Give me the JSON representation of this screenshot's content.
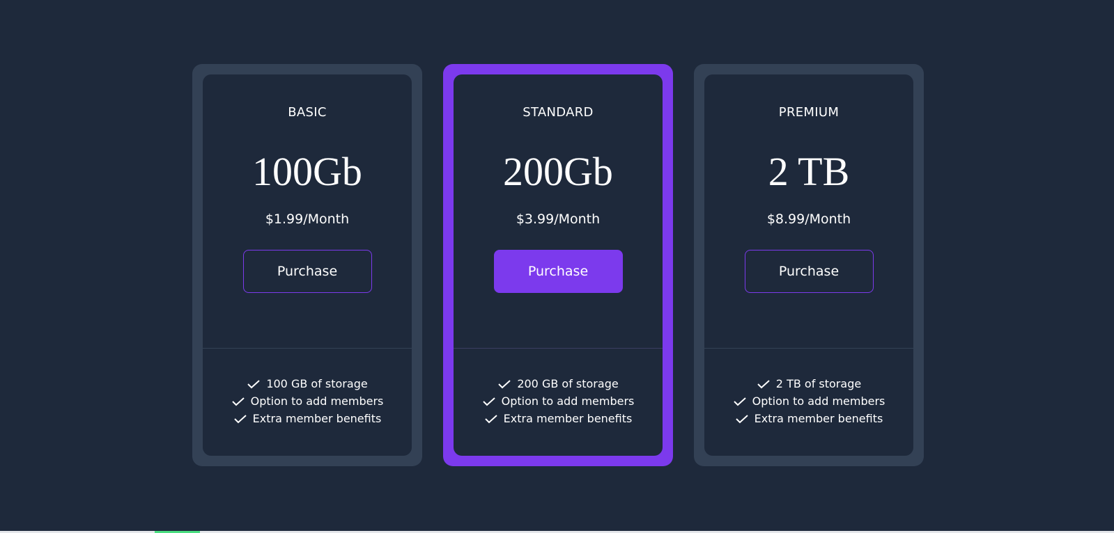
{
  "plans": [
    {
      "tier": "BASIC",
      "capacity": "100Gb",
      "price": "$1.99/Month",
      "button_label": "Purchase",
      "features": [
        "100 GB of storage",
        "Option to add members",
        "Extra member benefits"
      ]
    },
    {
      "tier": "STANDARD",
      "capacity": "200Gb",
      "price": "$3.99/Month",
      "button_label": "Purchase",
      "features": [
        "200 GB of storage",
        "Option to add members",
        "Extra member benefits"
      ]
    },
    {
      "tier": "PREMIUM",
      "capacity": "2 TB",
      "price": "$8.99/Month",
      "button_label": "Purchase",
      "features": [
        "2 TB of storage",
        "Option to add members",
        "Extra member benefits"
      ]
    }
  ],
  "icons": {
    "feature_check": "check-icon"
  },
  "colors": {
    "background": "#1e293b",
    "card_border": "#334155",
    "accent": "#7c3aed",
    "text": "#ffffff"
  }
}
